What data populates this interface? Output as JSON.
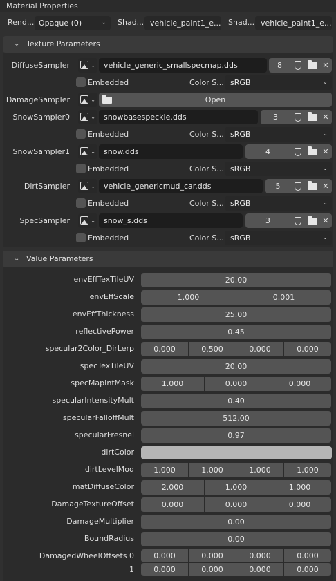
{
  "header": {
    "title": "Material Properties"
  },
  "toprow": {
    "render_label": "Rend...",
    "render_value": "Opaque (0)",
    "shader1_label": "Shad...",
    "shader1_value": "vehicle_paint1_e...",
    "shader2_label": "Shad...",
    "shader2_value": "vehicle_paint1_e..."
  },
  "texture_section": {
    "title": "Texture Parameters"
  },
  "value_section": {
    "title": "Value Parameters"
  },
  "common": {
    "embedded": "Embedded",
    "color_space_label": "Color S...",
    "open": "Open"
  },
  "textures": [
    {
      "label": "DiffuseSampler",
      "file": "vehicle_generic_smallspecmap.dds",
      "num": "8",
      "color_space": "sRGB"
    },
    {
      "label": "DamageSampler",
      "file": "",
      "num": "",
      "color_space": ""
    },
    {
      "label": "SnowSampler0",
      "file": "snowbasespeckle.dds",
      "num": "3",
      "color_space": "sRGB"
    },
    {
      "label": "SnowSampler1",
      "file": "snow.dds",
      "num": "4",
      "color_space": "sRGB"
    },
    {
      "label": "DirtSampler",
      "file": "vehicle_genericmud_car.dds",
      "num": "5",
      "color_space": "sRGB"
    },
    {
      "label": "SpecSampler",
      "file": "snow_s.dds",
      "num": "3",
      "color_space": "sRGB"
    }
  ],
  "values": [
    {
      "label": "envEffTexTileUV",
      "vals": [
        "20.00"
      ]
    },
    {
      "label": "envEffScale",
      "vals": [
        "1.000",
        "0.001"
      ]
    },
    {
      "label": "envEffThickness",
      "vals": [
        "25.00"
      ]
    },
    {
      "label": "reflectivePower",
      "vals": [
        "0.45"
      ]
    },
    {
      "label": "specular2Color_DirLerp",
      "vals": [
        "0.000",
        "0.500",
        "0.000",
        "0.000"
      ]
    },
    {
      "label": "specTexTileUV",
      "vals": [
        "20.00"
      ]
    },
    {
      "label": "specMapIntMask",
      "vals": [
        "1.000",
        "0.000",
        "0.000"
      ]
    },
    {
      "label": "specularIntensityMult",
      "vals": [
        "0.40"
      ]
    },
    {
      "label": "specularFalloffMult",
      "vals": [
        "512.00"
      ]
    },
    {
      "label": "specularFresnel",
      "vals": [
        "0.97"
      ]
    },
    {
      "label": "dirtColor",
      "vals": [],
      "color": "#b5b5b5"
    },
    {
      "label": "dirtLevelMod",
      "vals": [
        "1.000",
        "1.000",
        "1.000",
        "1.000"
      ]
    },
    {
      "label": "matDiffuseColor",
      "vals": [
        "2.000",
        "1.000",
        "1.000"
      ]
    },
    {
      "label": "DamageTextureOffset",
      "vals": [
        "0.000",
        "0.000",
        "0.000"
      ]
    },
    {
      "label": "DamageMultiplier",
      "vals": [
        "0.00"
      ]
    },
    {
      "label": "BoundRadius",
      "vals": [
        "0.00"
      ]
    },
    {
      "label": "DamagedWheelOffsets 0",
      "vals": [
        "0.000",
        "0.000",
        "0.000",
        "0.000"
      ]
    },
    {
      "label": "1",
      "vals": [
        "0.000",
        "0.000",
        "0.000",
        "0.000"
      ]
    }
  ]
}
